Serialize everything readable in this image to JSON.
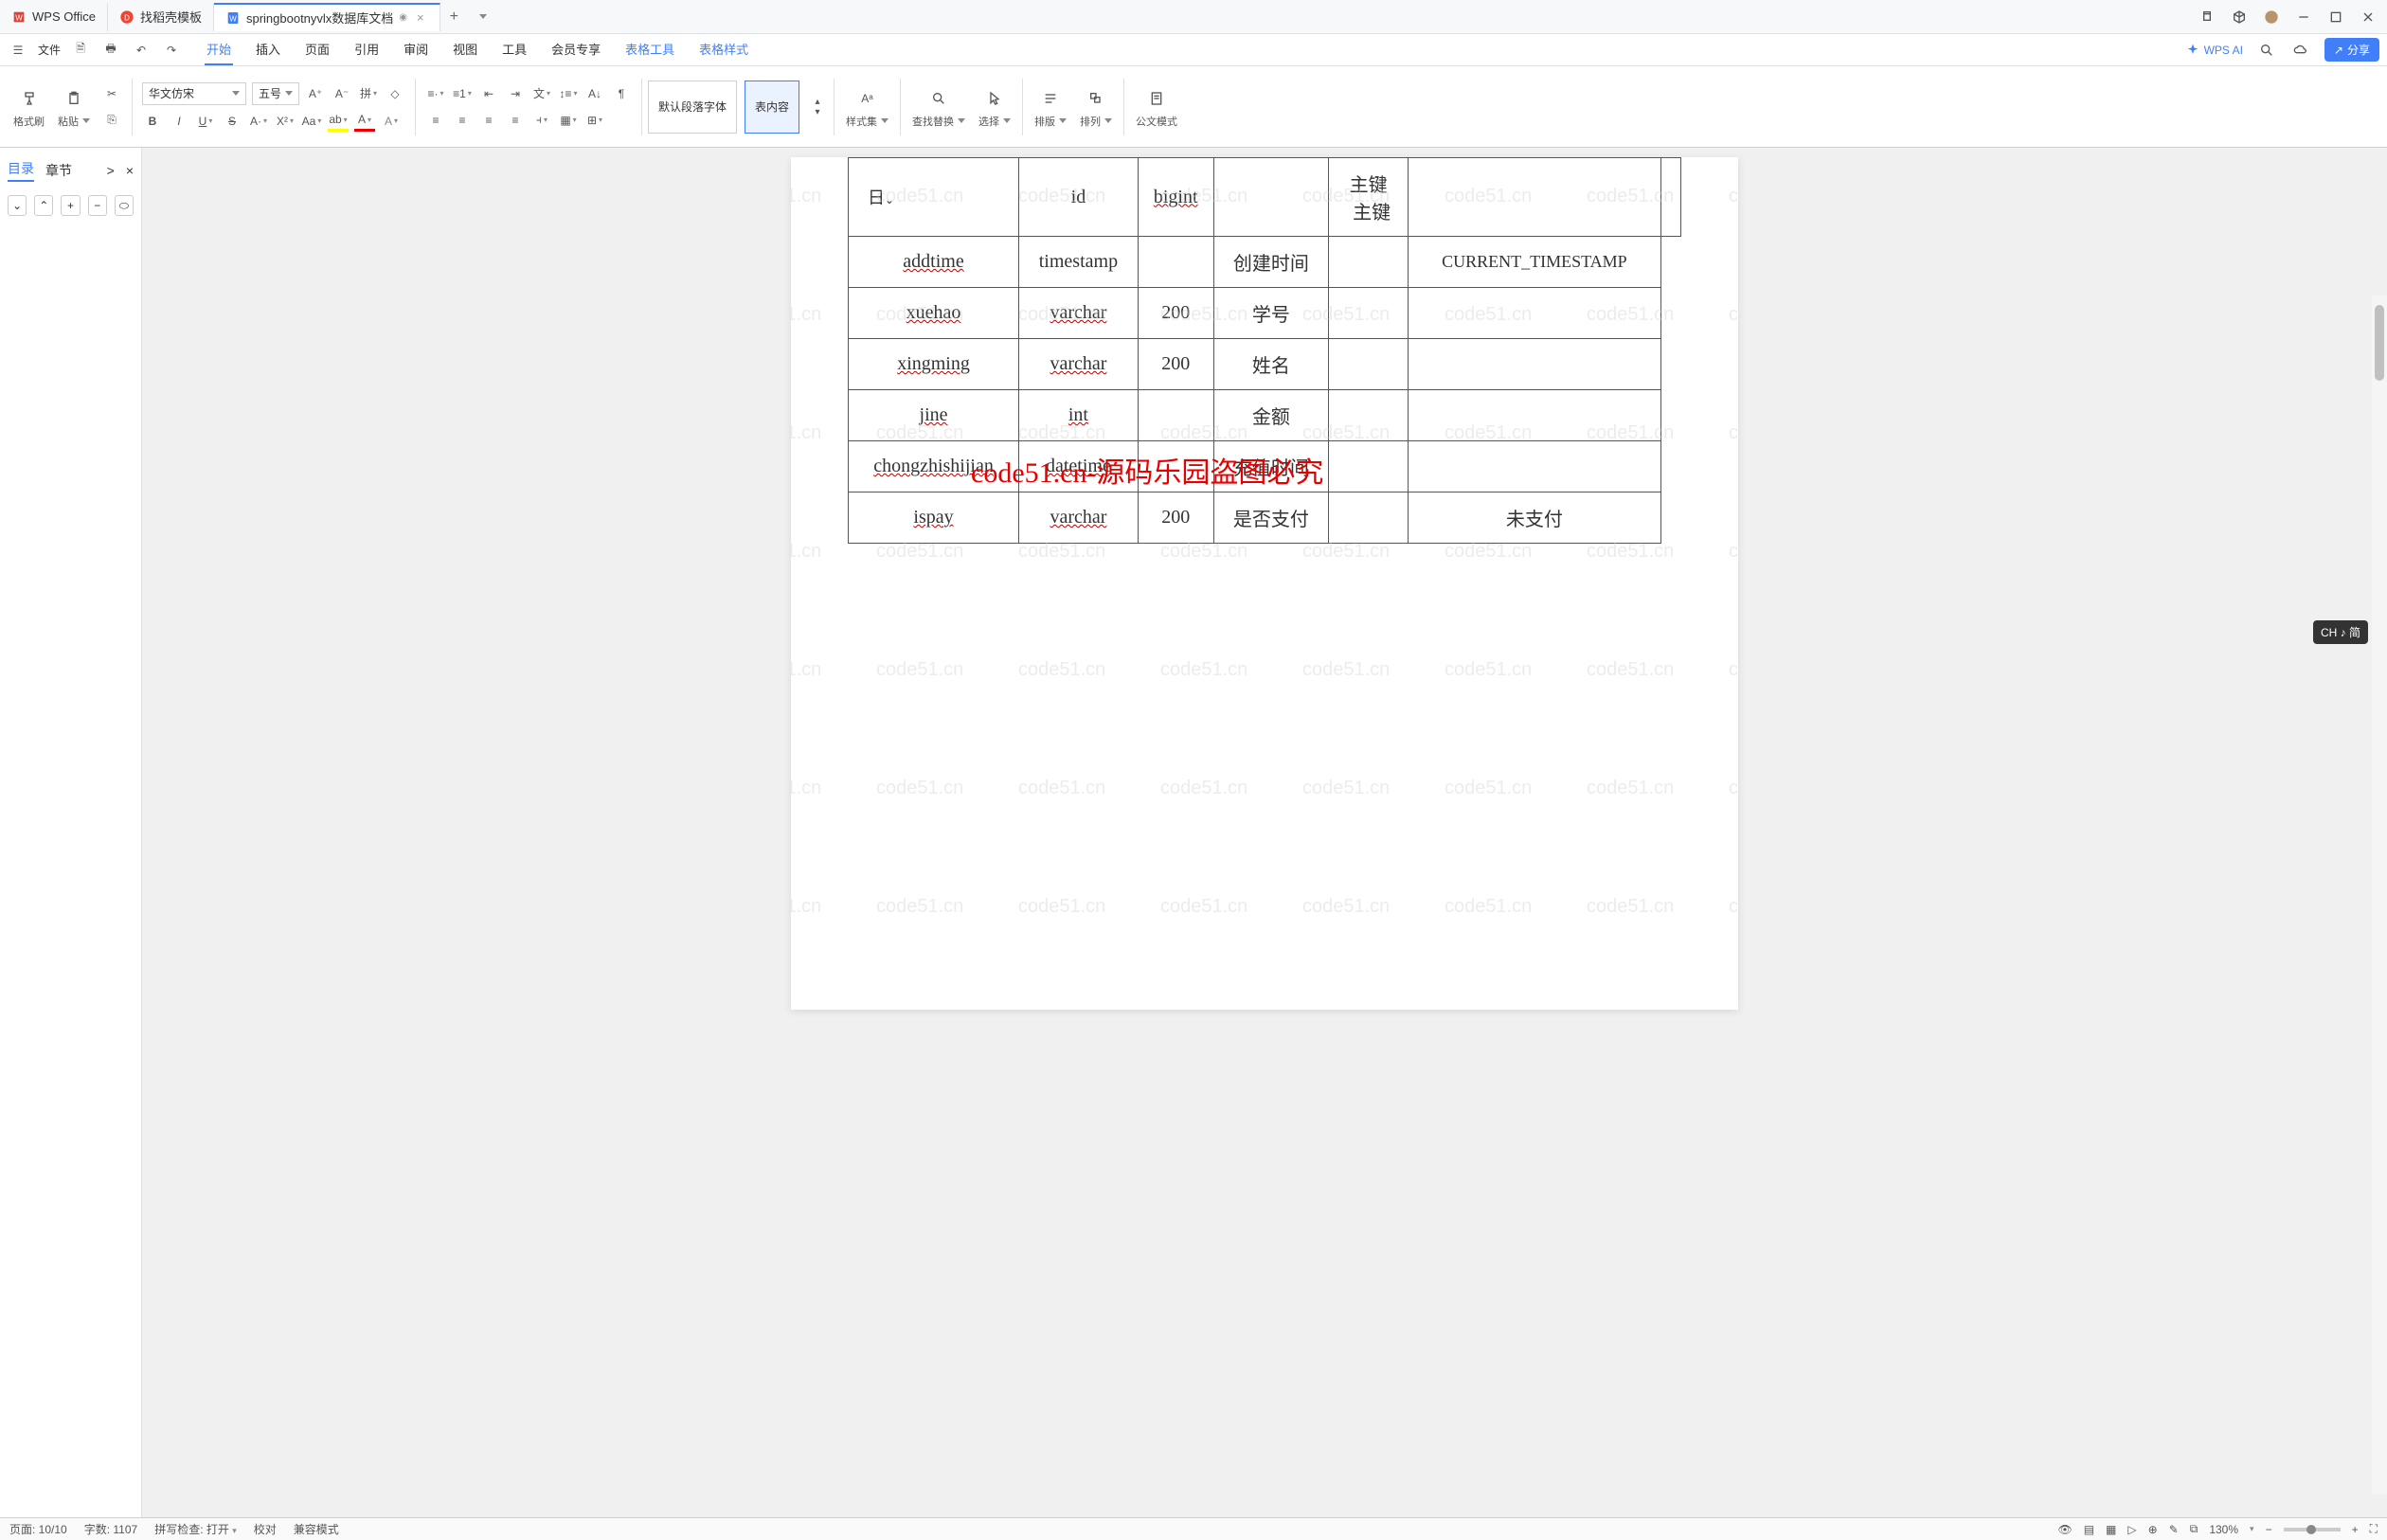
{
  "titlebar": {
    "tab1_label": "WPS Office",
    "tab2_label": "找稻壳模板",
    "tab3_label": "springbootnyvlx数据库文档",
    "add": "+"
  },
  "menubar": {
    "file": "文件",
    "tabs": [
      "开始",
      "插入",
      "页面",
      "引用",
      "审阅",
      "视图",
      "工具",
      "会员专享",
      "表格工具",
      "表格样式"
    ],
    "active_idx": 0,
    "ai": "WPS AI",
    "share": "分享"
  },
  "ribbon": {
    "format_painter": "格式刷",
    "paste": "粘贴",
    "font_name": "华文仿宋",
    "font_size": "五号",
    "style_default": "默认段落字体",
    "style_content": "表内容",
    "style_set": "样式集",
    "find_replace": "查找替换",
    "select": "选择",
    "layout": "排版",
    "arrange": "排列",
    "official": "公文模式"
  },
  "sidepanel": {
    "outline": "目录",
    "chapter": "章节",
    "close": "×",
    "nav": ">"
  },
  "document": {
    "watermark_text": "code51.cn",
    "row_header": "日",
    "banner": "code51.cn-源码乐园盗图必究",
    "key_extra": "主键",
    "rows": [
      {
        "field": "id",
        "type": "bigint",
        "len": "",
        "desc": "主键",
        "default": ""
      },
      {
        "field": "addtime",
        "type": "timestamp",
        "len": "",
        "desc": "创建时间",
        "default": "CURRENT_TIMESTAMP"
      },
      {
        "field": "xuehao",
        "type": "varchar",
        "len": "200",
        "desc": "学号",
        "default": ""
      },
      {
        "field": "xingming",
        "type": "varchar",
        "len": "200",
        "desc": "姓名",
        "default": ""
      },
      {
        "field": "jine",
        "type": "int",
        "len": "",
        "desc": "金额",
        "default": ""
      },
      {
        "field": "chongzhishijian",
        "type": "datetime",
        "len": "",
        "desc": "充值时间",
        "default": ""
      },
      {
        "field": "ispay",
        "type": "varchar",
        "len": "200",
        "desc": "是否支付",
        "default": "未支付"
      }
    ]
  },
  "statusbar": {
    "page": "页面: 10/10",
    "words": "字数: 1107",
    "spell": "拼写检查: 打开",
    "proof": "校对",
    "compat": "兼容模式",
    "zoom": "130%"
  },
  "ime": {
    "label": "CH ♪ 简"
  }
}
